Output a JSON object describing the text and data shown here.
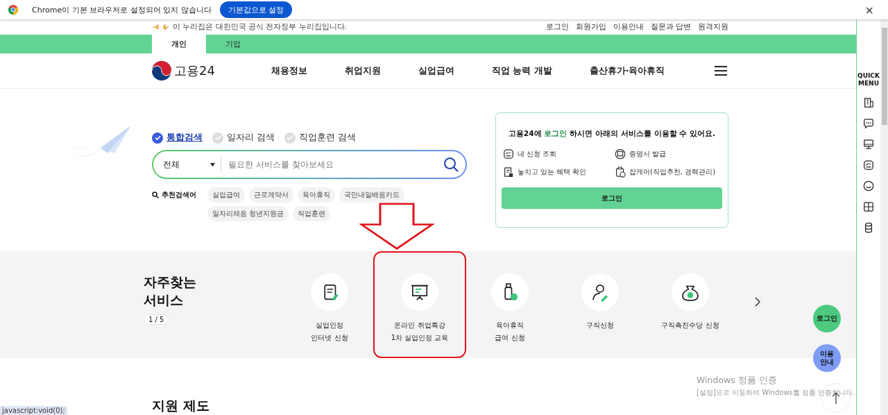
{
  "browser_bar": {
    "message": "Chrome이 기본 브라우저로 설정되어 있지 않습니다",
    "button": "기본값으로 설정",
    "close": "×"
  },
  "top_bar": {
    "notice": "이 누리집은 대한민국 공식 전자정부 누리집입니다.",
    "links": [
      "로그인",
      "회원가입",
      "이용안내",
      "질문과 답변",
      "원격지원"
    ]
  },
  "user_tabs": [
    {
      "label": "개인",
      "selected": true
    },
    {
      "label": "기업",
      "selected": false
    }
  ],
  "header": {
    "logo": "고용24",
    "nav": [
      "채용정보",
      "취업지원",
      "실업급여",
      "직업 능력 개발",
      "출산휴가·육아휴직"
    ]
  },
  "search": {
    "types": [
      {
        "label": "통합검색",
        "selected": true
      },
      {
        "label": "일자리 검색",
        "selected": false
      },
      {
        "label": "직업훈련 검색",
        "selected": false
      }
    ],
    "category": "전체",
    "placeholder": "필요한 서비스를 찾아보세요",
    "recommend_label": "추천검색어",
    "keywords": [
      "실업급여",
      "근로계약서",
      "육아휴직",
      "국민내일배움카드",
      "일자리채움 청년지원금",
      "직업훈련"
    ]
  },
  "login_card": {
    "title_before": "고용24에",
    "title_highlight": "로그인",
    "title_after": "하시면 아래의 서비스를 이용할 수 있어요.",
    "services": [
      "내 신청 조회",
      "증명서 발급",
      "놓치고 있는 혜택 확인",
      "잡케어(직업추천, 경력관리)"
    ],
    "button": "로그인"
  },
  "frequent": {
    "title": "자주찾는 서비스",
    "page": "1 / 5",
    "items": [
      {
        "lines": [
          "실업인정",
          "인터넷 신청"
        ],
        "highlighted": false
      },
      {
        "lines": [
          "온라인 취업특강",
          "1차 실업인정 교육"
        ],
        "highlighted": true
      },
      {
        "lines": [
          "육아휴직",
          "급여 신청"
        ],
        "highlighted": false
      },
      {
        "lines": [
          "구직신청"
        ],
        "highlighted": false
      },
      {
        "lines": [
          "구직촉진수당 신청"
        ],
        "highlighted": false
      }
    ]
  },
  "support_title": "지원 제도",
  "quick_menu": {
    "title": "QUICK MENU"
  },
  "floating": {
    "login": "로그인",
    "guide": "이용 안내"
  },
  "windows_notice": {
    "title": "Windows 정품 인증",
    "text": "[설정]으로 이동하여 Windows를 정품 인증합니다."
  },
  "status_url": "javascript:void(0);"
}
